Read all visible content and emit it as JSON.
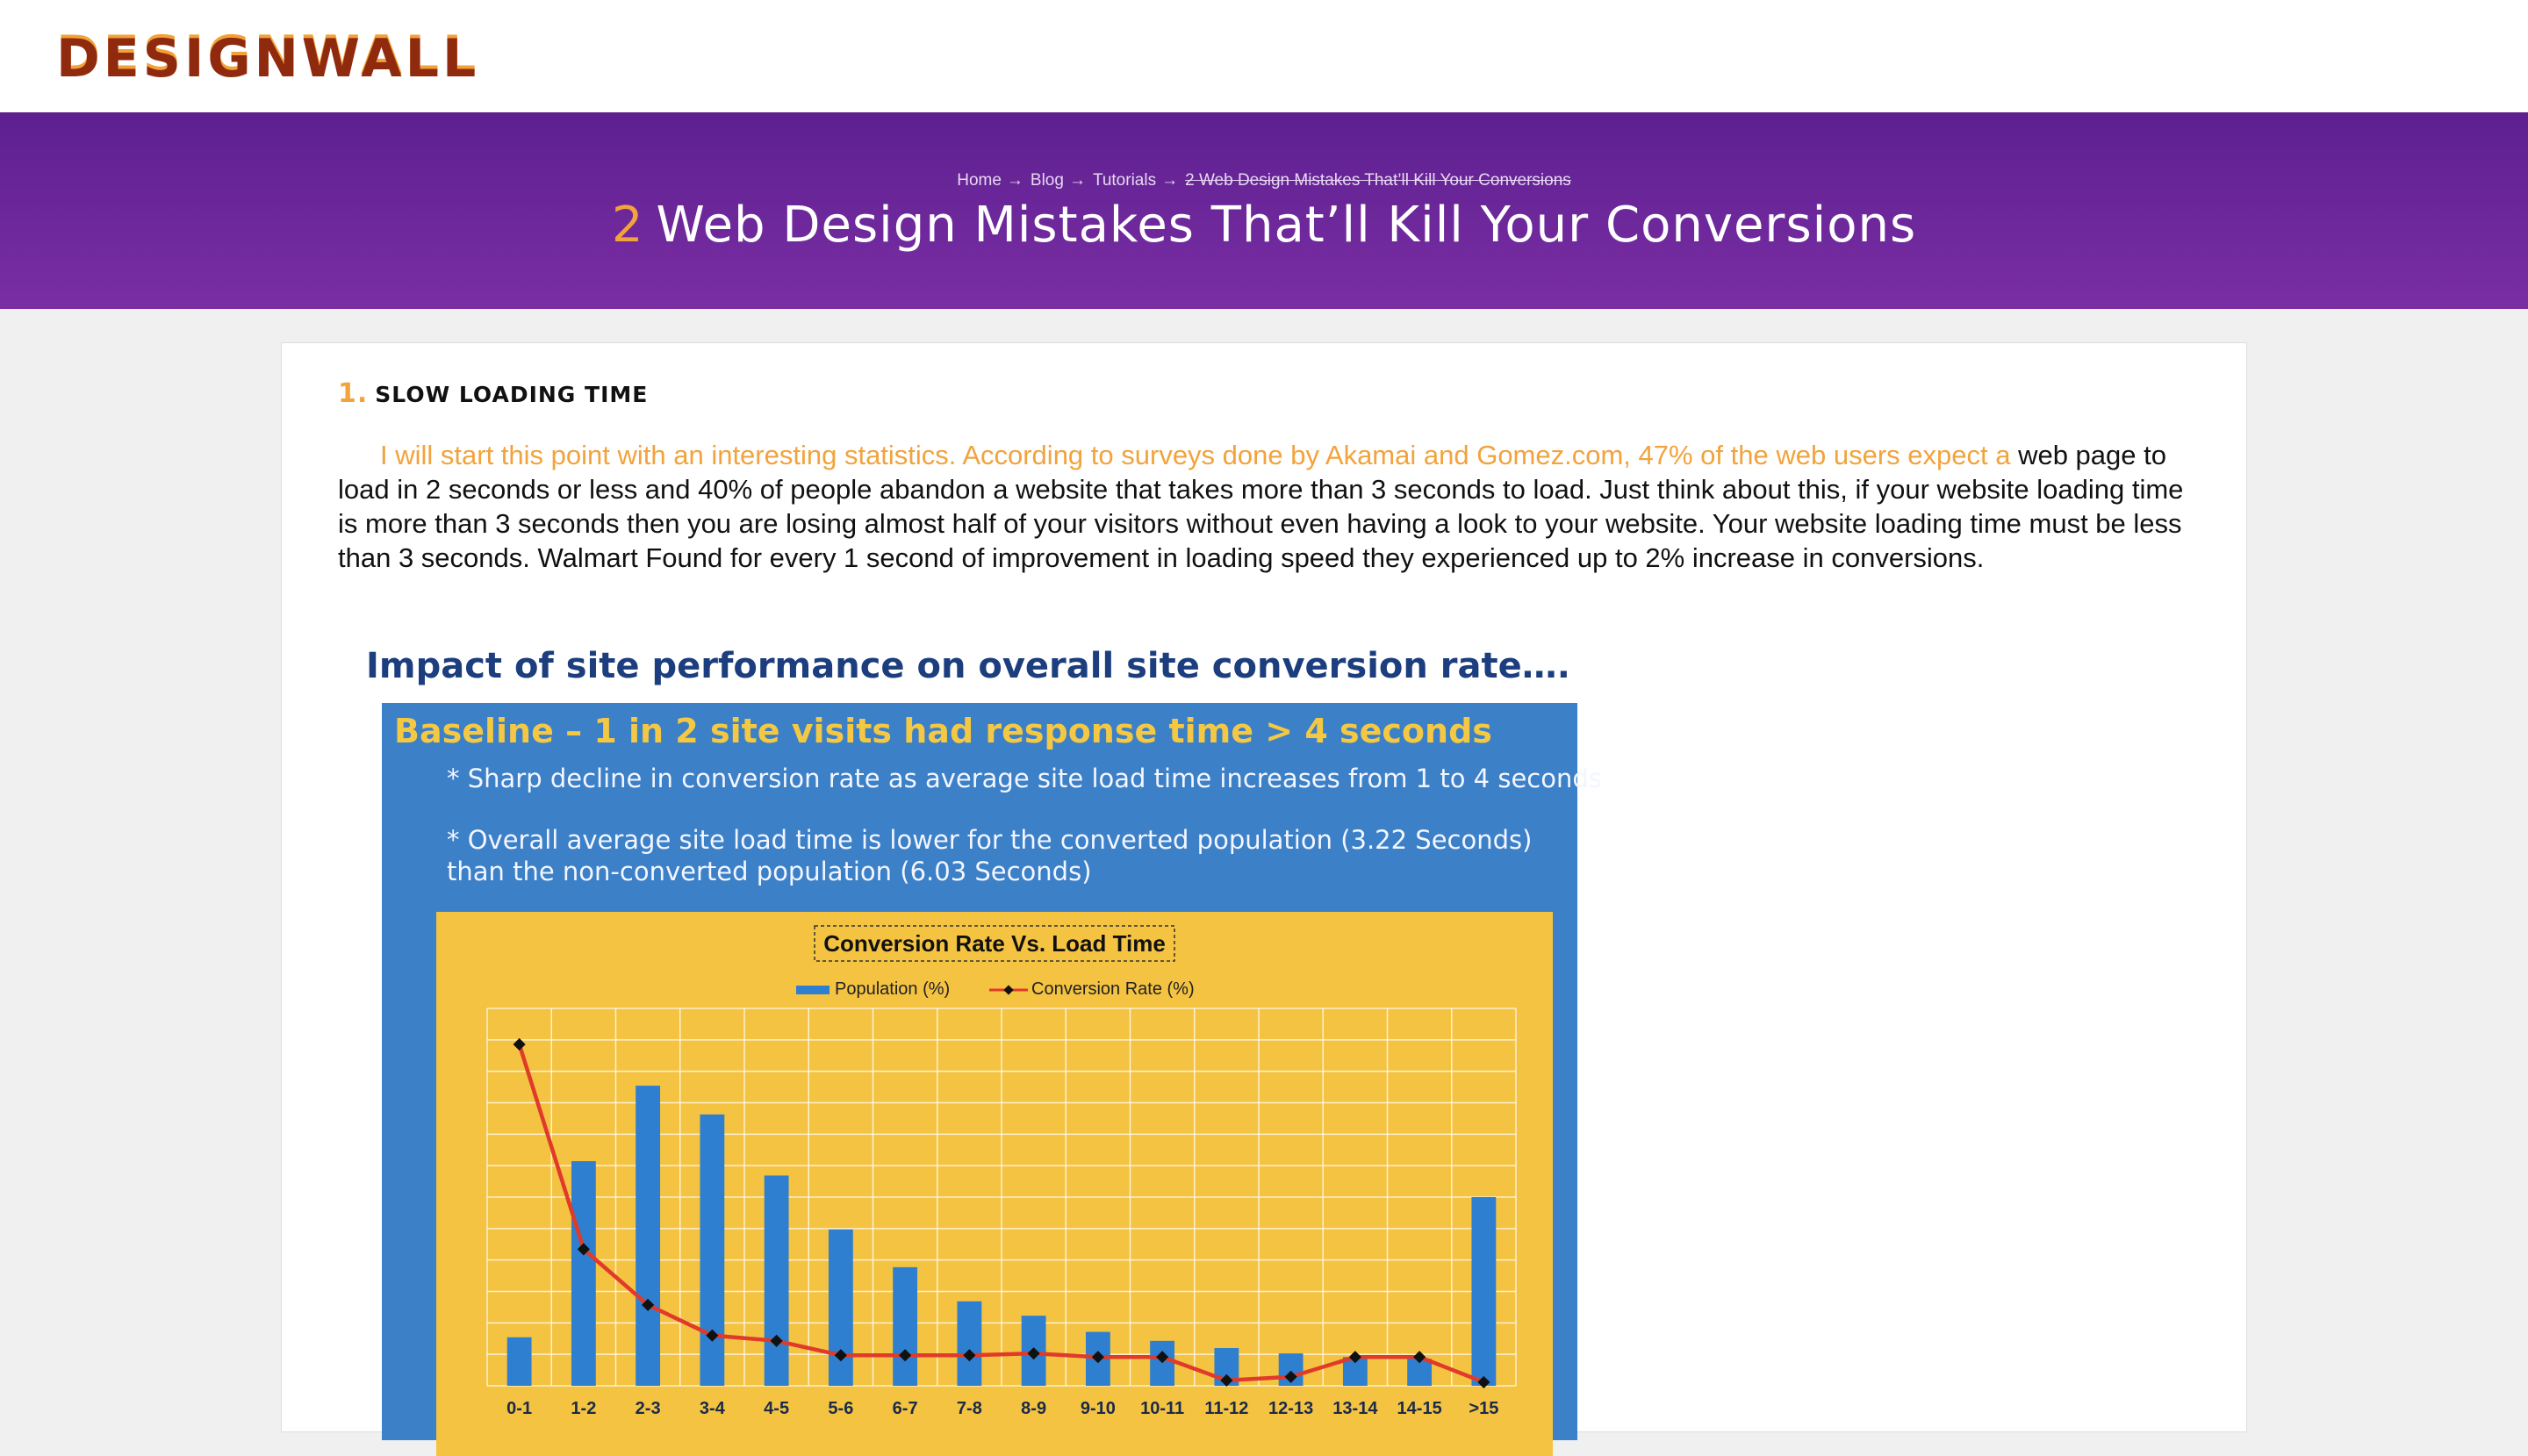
{
  "site": {
    "logo": "DESIGNWALL"
  },
  "breadcrumb": {
    "items": [
      {
        "label": "Home"
      },
      {
        "label": "Blog"
      },
      {
        "label": "Tutorials"
      }
    ],
    "current": "2 Web Design Mistakes That’ll Kill Your Conversions",
    "separator": "→"
  },
  "page": {
    "title_number": "2",
    "title_text": "Web Design Mistakes That’ll Kill Your Conversions"
  },
  "article": {
    "section_number": "1.",
    "section_title": "SLOW LOADING TIME",
    "paragraph_highlight": "I will start this point with an interesting statistics. According to surveys done by Akamai and Gomez.com, 47% of the web users expect a",
    "paragraph_rest": " web page to load in 2 seconds or less and 40% of people abandon a website that takes more than 3 seconds to load. Just think about this, if your website loading time is more than 3 seconds then you are losing almost half of your visitors without even having a look to your website. Your website loading time must be less than 3 seconds. Walmart Found for every 1 second of improvement in loading speed they experienced up to 2% increase in conversions."
  },
  "figure": {
    "title": "Impact of site performance on overall site conversion rate….",
    "subtitle": "Baseline – 1 in 2 site visits had response time > 4 seconds",
    "bullet1": "* Sharp decline in conversion rate as average site load time increases from 1 to 4 seconds",
    "bullet2": "* Overall average site load time is lower for the converted population (3.22 Seconds) than the non-converted population (6.03 Seconds)",
    "colors": {
      "panel_blue": "#3c80c8",
      "panel_yellow": "#f4c342",
      "title_navy": "#1c3e7e",
      "subtitle_yellow": "#f4c842",
      "bar_blue": "#2f7fd0",
      "line_red": "#e03a2a"
    }
  },
  "chart_data": {
    "type": "bar",
    "title": "Conversion Rate Vs. Load Time",
    "categories": [
      "0-1",
      "1-2",
      "2-3",
      "3-4",
      "4-5",
      "5-6",
      "6-7",
      "7-8",
      "8-9",
      "9-10",
      "10-11",
      "11-12",
      "12-13",
      "13-14",
      "14-15",
      ">15"
    ],
    "series": [
      {
        "name": "Population (%)",
        "kind": "bar",
        "values": [
          2.7,
          12.5,
          16.7,
          15.1,
          11.7,
          8.7,
          6.6,
          4.7,
          3.9,
          3.0,
          2.5,
          2.1,
          1.8,
          1.6,
          1.5,
          10.5
        ]
      },
      {
        "name": "Conversion Rate (%)",
        "kind": "line",
        "values": [
          19.0,
          7.6,
          4.5,
          2.8,
          2.5,
          1.7,
          1.7,
          1.7,
          1.8,
          1.6,
          1.6,
          0.3,
          0.5,
          1.6,
          1.6,
          0.2
        ]
      }
    ],
    "ylim": [
      0,
      21
    ],
    "grid": true,
    "legend": "top-center"
  }
}
